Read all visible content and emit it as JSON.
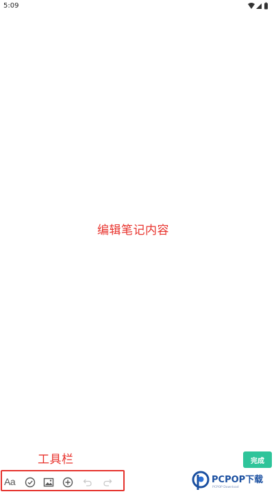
{
  "status_bar": {
    "time": "5:09"
  },
  "annotations": {
    "main": "编辑笔记内容",
    "toolbar": "工具栏"
  },
  "done_button": {
    "label": "完成",
    "color": "#2ec49a"
  },
  "toolbar": {
    "font_label": "Aa",
    "items": [
      {
        "icon": "text-format-icon"
      },
      {
        "icon": "checklist-icon"
      },
      {
        "icon": "image-icon"
      },
      {
        "icon": "add-icon"
      },
      {
        "icon": "undo-icon"
      },
      {
        "icon": "redo-icon"
      }
    ]
  },
  "watermark": {
    "text": "PCPOP下载",
    "subtext": "PCPOP Download"
  },
  "colors": {
    "annotation": "#e8322c",
    "highlight_box": "#e5312b",
    "accent": "#2ec49a",
    "watermark": "#1a4fa0"
  }
}
